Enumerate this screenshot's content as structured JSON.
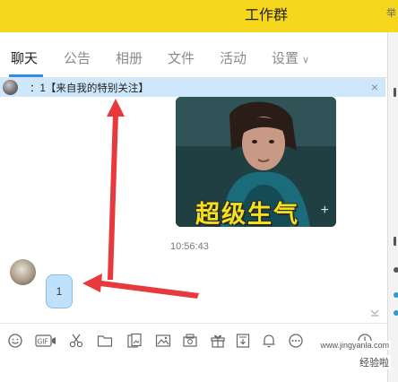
{
  "window": {
    "title": "工作群",
    "edge_char": "举"
  },
  "tabs": [
    {
      "label": "聊天"
    },
    {
      "label": "公告"
    },
    {
      "label": "相册"
    },
    {
      "label": "文件"
    },
    {
      "label": "活动"
    },
    {
      "label": "设置",
      "chevron": "∨"
    }
  ],
  "notice": {
    "text": "：1【来自我的特别关注】",
    "close": "×"
  },
  "message": {
    "sticker_text": "超级生气",
    "sticker_plus": "+",
    "time": "10:56:43",
    "bubble_text": "1"
  },
  "toolbar": {
    "icons": [
      "emoji-icon",
      "gif-icon",
      "scissors-icon",
      "folder-icon",
      "image-file-icon",
      "image-icon",
      "gallery-icon",
      "gift-icon",
      "save-icon",
      "bell-icon",
      "more-icon",
      "clock-icon"
    ],
    "gif_label": "GIF"
  },
  "watermark": {
    "line1": "www.jingyanla.com",
    "line2": "经验啦"
  },
  "colors": {
    "header": "#f5d71e",
    "notice_bg": "#cfe7fb",
    "bubble": "#bfe1fb",
    "arrow": "#e8393d",
    "tab_underline": "#2d8cf0"
  }
}
